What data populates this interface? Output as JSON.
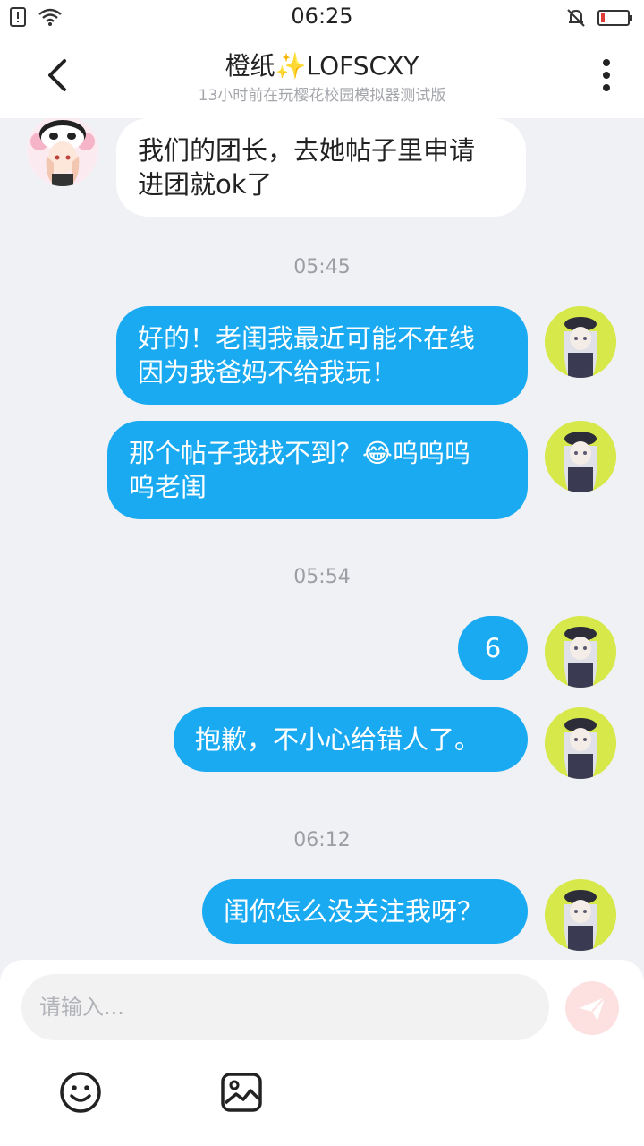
{
  "status_bar": {
    "time": "06:25",
    "icons": [
      "sim-alert-icon",
      "wifi-icon",
      "mute-bell-icon",
      "battery-low-icon"
    ]
  },
  "header": {
    "title": "橙纸✨LOFSCXY",
    "subtitle": "13小时前在玩樱花校园模拟器测试版",
    "icons": [
      "back-arrow-icon",
      "more-vertical-icon"
    ]
  },
  "messages": [
    {
      "sender": "other",
      "text": "我们的团长，去她帖子里申请\n进团就ok了"
    },
    {
      "timestamp": "05:45"
    },
    {
      "sender": "me",
      "text": "好的！老闺我最近可能不在线\n因为我爸妈不给我玩！"
    },
    {
      "sender": "me",
      "text": "那个帖子我找不到？😂呜呜呜\n呜老闺"
    },
    {
      "timestamp": "05:54"
    },
    {
      "sender": "me",
      "text": "6"
    },
    {
      "sender": "me",
      "text": "抱歉，不小心给错人了。"
    },
    {
      "timestamp": "06:12"
    },
    {
      "sender": "me",
      "text": "闺你怎么没关注我呀？"
    }
  ],
  "composer": {
    "placeholder": "请输入...",
    "icons": [
      "send-icon",
      "emoji-icon",
      "image-icon"
    ]
  },
  "colors": {
    "my_bubble": "#19aaf2",
    "other_bubble": "#ffffff",
    "background": "#f0f1f4",
    "send_button": "#fde1e0"
  }
}
